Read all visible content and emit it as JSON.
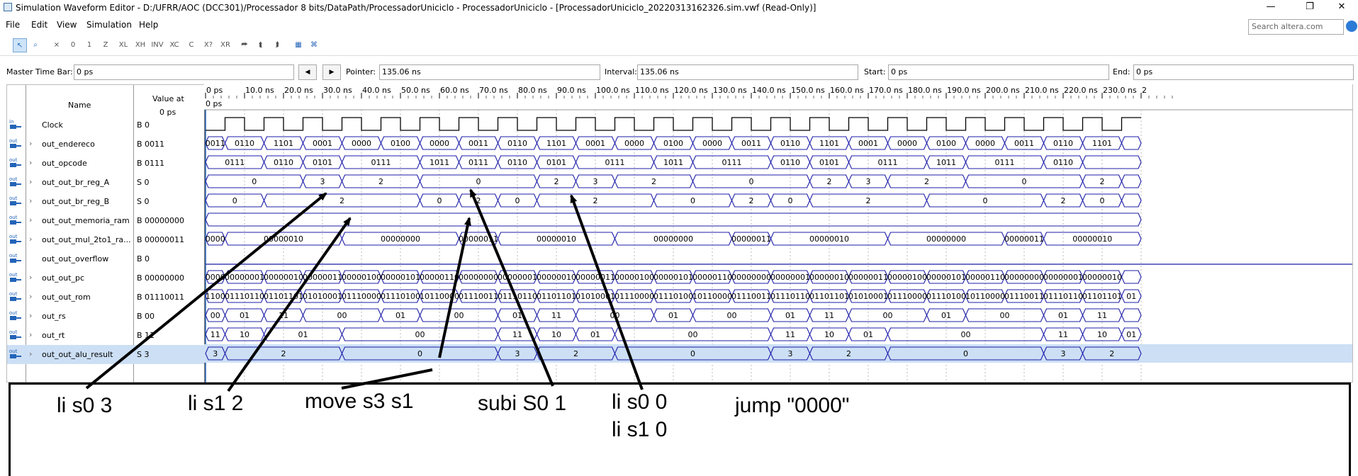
{
  "window": {
    "title": "Simulation Waveform Editor - D:/UFRR/AOC (DCC301)/Processador 8 bits/DataPath/ProcessadorUniciclo - ProcessadorUniciclo - [ProcessadorUniciclo_20220313162326.sim.vwf (Read-Only)]",
    "minimize": "—",
    "maximize": "❐",
    "close": "✕"
  },
  "menu": [
    "File",
    "Edit",
    "View",
    "Simulation",
    "Help"
  ],
  "search": {
    "placeholder": "Search altera.com"
  },
  "toolbar": {
    "icons": [
      "pointer-icon",
      "zoom-icon",
      "force-unknown-icon",
      "force-low-icon",
      "force-high-icon",
      "force-hiz-icon",
      "force-weak-low-icon",
      "force-weak-high-icon",
      "invert-icon",
      "count-value-icon",
      "clock-icon",
      "random-icon",
      "arbitrary-value-icon",
      "snap-grid-icon",
      "insert-node-icon",
      "group-icon",
      "grid-icon",
      "overwrite-clock-icon"
    ],
    "labels": [
      "↖",
      "⌕",
      "⨯",
      "0",
      "1",
      "Z",
      "XL",
      "XH",
      "INV",
      "XC",
      "C",
      "X?",
      "XR",
      "⮫",
      "⮬",
      "⮭",
      "▦",
      "⌘"
    ]
  },
  "timebar": {
    "master_label": "Master Time Bar:",
    "master_value": "0 ps",
    "pointer_label": "Pointer:",
    "pointer_value": "135.06 ns",
    "interval_label": "Interval:",
    "interval_value": "135.06 ns",
    "start_label": "Start:",
    "start_value": "0 ps",
    "end_label": "End:",
    "end_value": "0 ps",
    "prev": "◀",
    "next": "▶"
  },
  "columns": {
    "name": "Name",
    "value_at": "Value at",
    "value_time": "0 ps",
    "time_origin": "0 ps"
  },
  "time_ticks": [
    "0 ps",
    "10.0 ns",
    "20.0 ns",
    "30.0 ns",
    "40.0 ns",
    "50.0 ns",
    "60.0 ns",
    "70.0 ns",
    "80.0 ns",
    "90.0 ns",
    "100.0 ns",
    "110.0 ns",
    "120.0 ns",
    "130.0 ns",
    "140.0 ns",
    "150.0 ns",
    "160.0 ns",
    "170.0 ns",
    "180.0 ns",
    "190.0 ns",
    "200.0 ns",
    "210.0 ns",
    "220.0 ns",
    "230.0 ns",
    "2"
  ],
  "signals": [
    {
      "dir": "in",
      "name": "Clock",
      "value": "B 0",
      "type": "clock"
    },
    {
      "dir": "out",
      "name": "out_endereco",
      "value": "B 0011",
      "type": "bus",
      "segments": [
        [
          "0011",
          0,
          1
        ],
        [
          "0110",
          1,
          3
        ],
        [
          "1101",
          3,
          5
        ],
        [
          "0001",
          5,
          7
        ],
        [
          "0000",
          7,
          9
        ],
        [
          "0100",
          9,
          11
        ],
        [
          "0000",
          11,
          13
        ],
        [
          "0011",
          13,
          15
        ],
        [
          "0110",
          15,
          17
        ],
        [
          "1101",
          17,
          19
        ],
        [
          "0001",
          19,
          21
        ],
        [
          "0000",
          21,
          23
        ],
        [
          "0100",
          23,
          25
        ],
        [
          "0000",
          25,
          27
        ],
        [
          "0011",
          27,
          29
        ],
        [
          "0110",
          29,
          31
        ],
        [
          "1101",
          31,
          33
        ],
        [
          "0001",
          33,
          35
        ],
        [
          "0000",
          35,
          37
        ],
        [
          "0100",
          37,
          39
        ],
        [
          "0000",
          39,
          41
        ],
        [
          "0011",
          41,
          43
        ],
        [
          "0110",
          43,
          45
        ],
        [
          "1101",
          45,
          47
        ],
        [
          "",
          47,
          48
        ]
      ]
    },
    {
      "dir": "out",
      "name": "out_opcode",
      "value": "B 0111",
      "type": "bus",
      "segments": [
        [
          "0111",
          0,
          3
        ],
        [
          "0110",
          3,
          5
        ],
        [
          "0101",
          5,
          7
        ],
        [
          "0111",
          7,
          11
        ],
        [
          "1011",
          11,
          13
        ],
        [
          "0111",
          13,
          15
        ],
        [
          "0110",
          15,
          17
        ],
        [
          "0101",
          17,
          19
        ],
        [
          "0111",
          19,
          23
        ],
        [
          "1011",
          23,
          25
        ],
        [
          "0111",
          25,
          29
        ],
        [
          "0110",
          29,
          31
        ],
        [
          "0101",
          31,
          33
        ],
        [
          "0111",
          33,
          37
        ],
        [
          "1011",
          37,
          39
        ],
        [
          "0111",
          39,
          43
        ],
        [
          "0110",
          43,
          45
        ],
        [
          "",
          45,
          48
        ]
      ]
    },
    {
      "dir": "out",
      "name": "out_out_br_reg_A",
      "value": "S 0",
      "type": "bus",
      "segments": [
        [
          "0",
          0,
          5
        ],
        [
          "3",
          5,
          7
        ],
        [
          "2",
          7,
          11
        ],
        [
          "0",
          11,
          17
        ],
        [
          "2",
          17,
          19
        ],
        [
          "3",
          19,
          21
        ],
        [
          "2",
          21,
          25
        ],
        [
          "0",
          25,
          31
        ],
        [
          "2",
          31,
          33
        ],
        [
          "3",
          33,
          35
        ],
        [
          "2",
          35,
          39
        ],
        [
          "0",
          39,
          45
        ],
        [
          "2",
          45,
          47
        ],
        [
          "",
          47,
          48
        ]
      ]
    },
    {
      "dir": "out",
      "name": "out_out_br_reg_B",
      "value": "S 0",
      "type": "bus",
      "segments": [
        [
          "0",
          0,
          3
        ],
        [
          "2",
          3,
          11
        ],
        [
          "0",
          11,
          13
        ],
        [
          "2",
          13,
          15
        ],
        [
          "0",
          15,
          17
        ],
        [
          "2",
          17,
          23
        ],
        [
          "0",
          23,
          27
        ],
        [
          "2",
          27,
          29
        ],
        [
          "0",
          29,
          31
        ],
        [
          "2",
          31,
          37
        ],
        [
          "0",
          37,
          43
        ],
        [
          "2",
          43,
          45
        ],
        [
          "0",
          45,
          47
        ],
        [
          "",
          47,
          48
        ]
      ]
    },
    {
      "dir": "out",
      "name": "out_out_memoria_ram",
      "value": "B 00000000",
      "type": "bus",
      "segments": [
        [
          "",
          0,
          48
        ]
      ]
    },
    {
      "dir": "out",
      "name": "out_out_mul_2to1_ra...",
      "value": "B 00000011",
      "type": "bus",
      "segments": [
        [
          "0000",
          0,
          1
        ],
        [
          "00000010",
          1,
          7
        ],
        [
          "00000000",
          7,
          13
        ],
        [
          "00000011",
          13,
          15
        ],
        [
          "00000010",
          15,
          21
        ],
        [
          "00000000",
          21,
          27
        ],
        [
          "00000011",
          27,
          29
        ],
        [
          "00000010",
          29,
          35
        ],
        [
          "00000000",
          35,
          41
        ],
        [
          "00000011",
          41,
          43
        ],
        [
          "00000010",
          43,
          48
        ]
      ]
    },
    {
      "dir": "out",
      "name": "out_out_overflow",
      "value": "B 0",
      "type": "low"
    },
    {
      "dir": "out",
      "name": "out_out_pc",
      "value": "B 00000000",
      "type": "bus",
      "segments": [
        [
          "0000",
          0,
          1
        ],
        [
          "00000001",
          1,
          3
        ],
        [
          "00000010",
          3,
          5
        ],
        [
          "00000011",
          5,
          7
        ],
        [
          "00000100",
          7,
          9
        ],
        [
          "00000101",
          9,
          11
        ],
        [
          "00000110",
          11,
          13
        ],
        [
          "00000000",
          13,
          15
        ],
        [
          "00000001",
          15,
          17
        ],
        [
          "00000010",
          17,
          19
        ],
        [
          "00000011",
          19,
          21
        ],
        [
          "00000100",
          21,
          23
        ],
        [
          "00000101",
          23,
          25
        ],
        [
          "00000110",
          25,
          27
        ],
        [
          "00000000",
          27,
          29
        ],
        [
          "00000001",
          29,
          31
        ],
        [
          "00000010",
          31,
          33
        ],
        [
          "00000011",
          33,
          35
        ],
        [
          "00000100",
          35,
          37
        ],
        [
          "00000101",
          37,
          39
        ],
        [
          "00000110",
          39,
          41
        ],
        [
          "00000000",
          41,
          43
        ],
        [
          "00000001",
          43,
          45
        ],
        [
          "00000010",
          45,
          47
        ],
        [
          "",
          47,
          48
        ]
      ]
    },
    {
      "dir": "out",
      "name": "out_out_rom",
      "value": "B 01110011",
      "type": "bus",
      "segments": [
        [
          "1100",
          0,
          1
        ],
        [
          "01110110",
          1,
          3
        ],
        [
          "01101101",
          3,
          5
        ],
        [
          "01010001",
          5,
          7
        ],
        [
          "01110000",
          7,
          9
        ],
        [
          "01110100",
          9,
          11
        ],
        [
          "10110000",
          11,
          13
        ],
        [
          "01110011",
          13,
          15
        ],
        [
          "01110110",
          15,
          17
        ],
        [
          "01101101",
          17,
          19
        ],
        [
          "01010001",
          19,
          21
        ],
        [
          "01110000",
          21,
          23
        ],
        [
          "01110100",
          23,
          25
        ],
        [
          "10110000",
          25,
          27
        ],
        [
          "01110011",
          27,
          29
        ],
        [
          "01110110",
          29,
          31
        ],
        [
          "01101101",
          31,
          33
        ],
        [
          "01010001",
          33,
          35
        ],
        [
          "01110000",
          35,
          37
        ],
        [
          "01110100",
          37,
          39
        ],
        [
          "10110000",
          39,
          41
        ],
        [
          "01110011",
          41,
          43
        ],
        [
          "01110110",
          43,
          45
        ],
        [
          "01101101",
          45,
          47
        ],
        [
          "01",
          47,
          48
        ]
      ]
    },
    {
      "dir": "out",
      "name": "out_rs",
      "value": "B 00",
      "type": "bus",
      "segments": [
        [
          "00",
          0,
          1
        ],
        [
          "01",
          1,
          3
        ],
        [
          "11",
          3,
          5
        ],
        [
          "00",
          5,
          9
        ],
        [
          "01",
          9,
          11
        ],
        [
          "00",
          11,
          15
        ],
        [
          "01",
          15,
          17
        ],
        [
          "11",
          17,
          19
        ],
        [
          "00",
          19,
          23
        ],
        [
          "01",
          23,
          25
        ],
        [
          "00",
          25,
          29
        ],
        [
          "01",
          29,
          31
        ],
        [
          "11",
          31,
          33
        ],
        [
          "00",
          33,
          37
        ],
        [
          "01",
          37,
          39
        ],
        [
          "00",
          39,
          43
        ],
        [
          "01",
          43,
          45
        ],
        [
          "11",
          45,
          47
        ],
        [
          "",
          47,
          48
        ]
      ]
    },
    {
      "dir": "out",
      "name": "out_rt",
      "value": "B 11",
      "type": "bus",
      "segments": [
        [
          "11",
          0,
          1
        ],
        [
          "10",
          1,
          3
        ],
        [
          "01",
          3,
          7
        ],
        [
          "00",
          7,
          15
        ],
        [
          "11",
          15,
          17
        ],
        [
          "10",
          17,
          19
        ],
        [
          "01",
          19,
          21
        ],
        [
          "00",
          21,
          29
        ],
        [
          "11",
          29,
          31
        ],
        [
          "10",
          31,
          33
        ],
        [
          "01",
          33,
          35
        ],
        [
          "00",
          35,
          43
        ],
        [
          "11",
          43,
          45
        ],
        [
          "10",
          45,
          47
        ],
        [
          "01",
          47,
          48
        ]
      ]
    },
    {
      "dir": "out",
      "name": "out_out_alu_result",
      "value": "S 3",
      "type": "bus",
      "selected": true,
      "segments": [
        [
          "3",
          0,
          1
        ],
        [
          "2",
          1,
          7
        ],
        [
          "0",
          7,
          15
        ],
        [
          "3",
          15,
          17
        ],
        [
          "2",
          17,
          21
        ],
        [
          "0",
          21,
          29
        ],
        [
          "3",
          29,
          31
        ],
        [
          "2",
          31,
          35
        ],
        [
          "0",
          35,
          43
        ],
        [
          "3",
          43,
          45
        ],
        [
          "2",
          45,
          48
        ]
      ]
    }
  ],
  "annotations": {
    "notes": [
      "li s0 3",
      "li s1 2",
      "move s3 s1",
      "subi S0 1",
      "li s0 0",
      "li s1 0",
      "jump \"0000\""
    ]
  }
}
